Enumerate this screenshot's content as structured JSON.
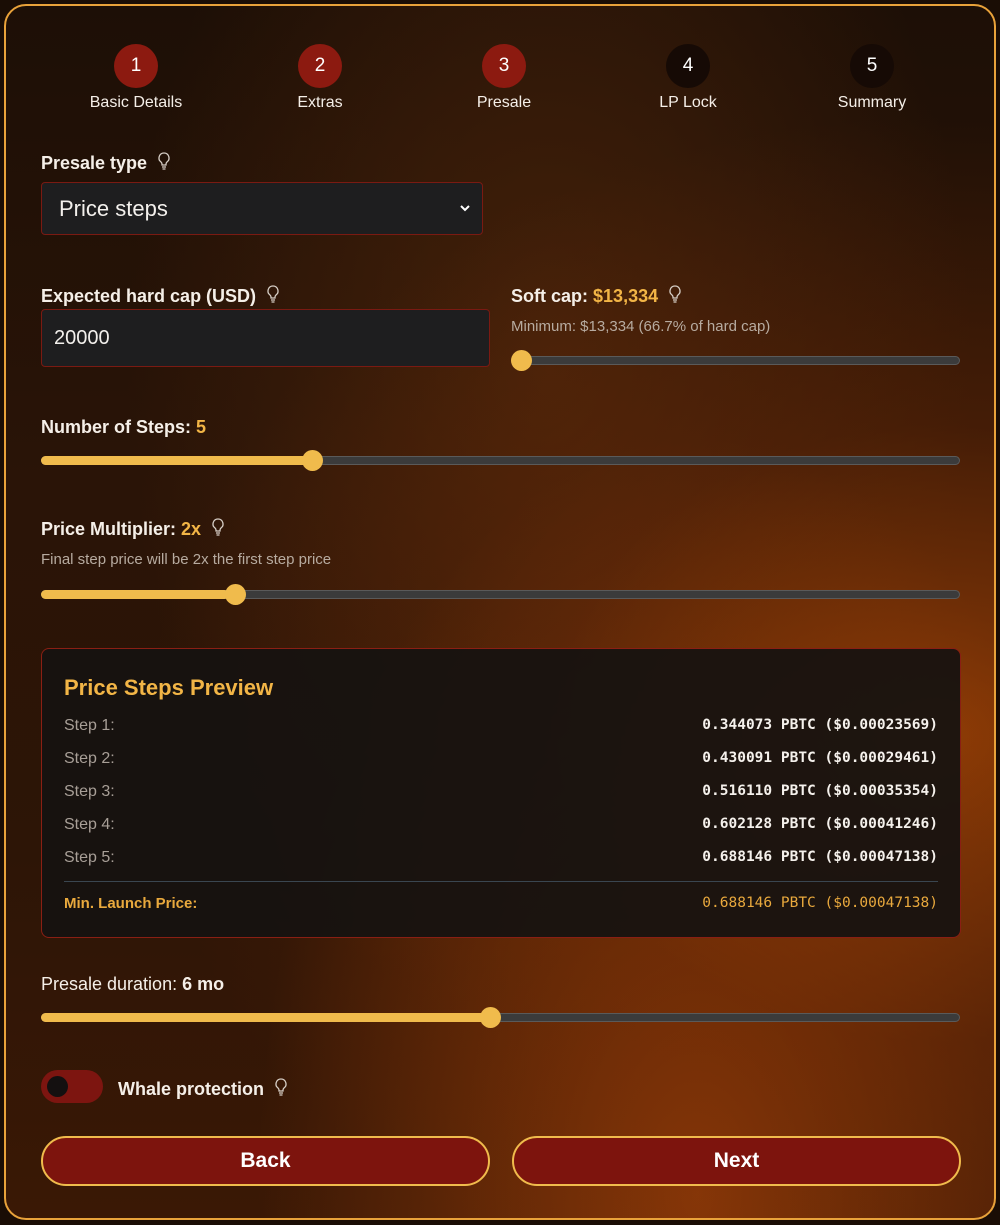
{
  "steps": [
    {
      "num": "1",
      "label": "Basic Details",
      "state": "done"
    },
    {
      "num": "2",
      "label": "Extras",
      "state": "done"
    },
    {
      "num": "3",
      "label": "Presale",
      "state": "current"
    },
    {
      "num": "4",
      "label": "LP Lock",
      "state": "todo"
    },
    {
      "num": "5",
      "label": "Summary",
      "state": "todo"
    }
  ],
  "presale_type": {
    "label": "Presale type",
    "value": "Price steps"
  },
  "hard_cap": {
    "label": "Expected hard cap (USD)",
    "value": "20000"
  },
  "soft_cap": {
    "label": "Soft cap:",
    "value": "$13,334",
    "hint": "Minimum: $13,334 (66.7% of hard cap)",
    "slider_fraction": 0.0
  },
  "num_steps": {
    "label": "Number of Steps:",
    "value": "5",
    "slider_fraction": 0.29
  },
  "price_multiplier": {
    "label": "Price Multiplier:",
    "value": "2x",
    "hint": "Final step price will be 2x the first step price",
    "slider_fraction": 0.205
  },
  "preview": {
    "title": "Price Steps Preview",
    "rows": [
      {
        "label": "Step 1:",
        "value": "0.344073 PBTC ($0.00023569)"
      },
      {
        "label": "Step 2:",
        "value": "0.430091 PBTC ($0.00029461)"
      },
      {
        "label": "Step 3:",
        "value": "0.516110 PBTC ($0.00035354)"
      },
      {
        "label": "Step 4:",
        "value": "0.602128 PBTC ($0.00041246)"
      },
      {
        "label": "Step 5:",
        "value": "0.688146 PBTC ($0.00047138)"
      }
    ],
    "min_launch_label": "Min. Launch Price:",
    "min_launch_value": "0.688146 PBTC ($0.00047138)"
  },
  "duration": {
    "label": "Presale duration:",
    "value": "6 mo",
    "slider_fraction": 0.488
  },
  "whale": {
    "label": "Whale protection",
    "enabled": false
  },
  "buttons": {
    "back": "Back",
    "next": "Next"
  },
  "colors": {
    "accent": "#f0bb4c",
    "step_done": "#8c1a10",
    "button_bg": "#7d140d"
  }
}
